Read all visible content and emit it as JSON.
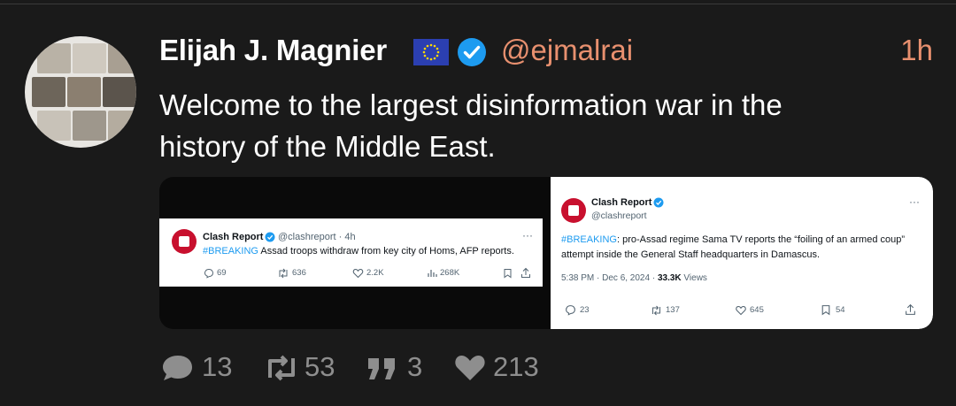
{
  "post": {
    "author_name": "Elijah J. Magnier",
    "flag": "EU flag",
    "handle": "@ejmalrai",
    "time": "1h",
    "text_line1": "Welcome to the largest disinformation war in the",
    "text_line2": "history of the Middle East."
  },
  "embed1": {
    "name": "Clash Report",
    "meta": "@clashreport · 4h",
    "hashtag": "#BREAKING",
    "body": " Assad troops withdraw from key city of Homs, AFP reports.",
    "replies": "69",
    "reposts": "636",
    "likes": "2.2K",
    "views": "268K"
  },
  "embed2": {
    "name": "Clash Report",
    "handle": "@clashreport",
    "hashtag": "#BREAKING",
    "body": ": pro-Assad regime Sama TV reports the “foiling of an armed coup” attempt inside the General Staff headquarters in Damascus.",
    "timestamp": "5:38 PM · Dec 6, 2024 · ",
    "views_count": "33.3K",
    "views_label": " Views",
    "replies": "23",
    "reposts": "137",
    "likes": "645",
    "bookmarks": "54"
  },
  "stats": {
    "replies": "13",
    "reposts": "53",
    "quotes": "3",
    "likes": "213"
  },
  "colors": {
    "background": "#1a1a1a",
    "accent": "#e8906f",
    "verified": "#1d9bf0",
    "stat_gray": "#8e8e8e"
  },
  "icons": [
    "verified-icon",
    "eu-flag-icon",
    "reply-icon",
    "repost-icon",
    "quote-icon",
    "like-icon",
    "views-icon",
    "bookmark-icon",
    "share-icon",
    "more-icon"
  ]
}
